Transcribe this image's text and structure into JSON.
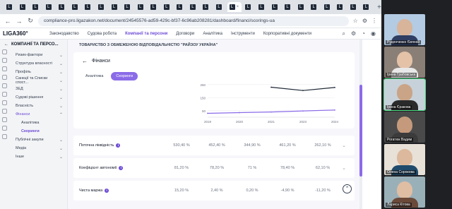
{
  "browser": {
    "tab_count": 28,
    "tab_close": "×",
    "new_tab": "+",
    "url": "compliance-pro.ligazakon.net/document/24545576-ad59-429c-bf37-6c96ab208281/dashboard/financi/scorings-ua",
    "nav": {
      "back": "←",
      "forward": "→",
      "reload": "↻"
    }
  },
  "app": {
    "logo": "LIGA360°",
    "nav": [
      "Законодавство",
      "Судова робота",
      "Компанії та персони",
      "Договори",
      "Аналітика",
      "Інструменти",
      "Корпоративні документи"
    ],
    "active_nav": 2
  },
  "sidebar": {
    "back_label": "КОМПАНІЇ ТА ПЕРСО...",
    "items": [
      {
        "label": "Ризик-фактори",
        "chev": "⌄"
      },
      {
        "label": "Структура власності",
        "chev": "⌄"
      },
      {
        "label": "Профіль",
        "chev": "⌄"
      },
      {
        "label": "Санкції та Списки спост...",
        "chev": "⌄"
      },
      {
        "label": "ЗЕД",
        "chev": "⌄"
      },
      {
        "label": "Судові рішення",
        "chev": "⌄"
      },
      {
        "label": "Власність",
        "chev": "⌄"
      },
      {
        "label": "Фінанси",
        "chev": "⌃"
      }
    ],
    "sub_items": [
      "Аналітика",
      "Скоринги"
    ],
    "items_after": [
      {
        "label": "Публічні закупи",
        "chev": "⌄"
      },
      {
        "label": "Медіа",
        "chev": "⌄"
      },
      {
        "label": "Інше",
        "chev": "⌄"
      }
    ]
  },
  "main": {
    "company": "ТОВАРИСТВО З ОБМЕЖЕНОЮ ВІДПОВІДАЛЬНІСТЮ \"РАЙЗОУ УКРАЇНА\"",
    "title": "Фінанси",
    "tabs": [
      "Аналітика",
      "Скоринги"
    ],
    "active_tab": 1,
    "rows": [
      {
        "label": "Поточна ліквідність",
        "values": [
          "530,40 %",
          "452,40 %",
          "344,90 %",
          "461,20 %",
          "262,10 %"
        ]
      },
      {
        "label": "Коефіцієнт автономії",
        "values": [
          "81,20 %",
          "78,20 %",
          "71 %",
          "78,40 %",
          "62,10 %"
        ]
      },
      {
        "label": "Чиста маржа",
        "values": [
          "15,20 %",
          "2,40 %",
          "0,20 %",
          "-4,90 %",
          "-11,20 %"
        ]
      }
    ]
  },
  "chart_data": {
    "type": "line",
    "x": [
      "2019",
      "2020",
      "2021",
      "2023",
      "2024"
    ],
    "y_ticks": [
      "250",
      "150",
      "50"
    ],
    "series": [
      {
        "values": [
          null,
          null,
          230,
          205,
          228
        ],
        "color": "#1f2937"
      },
      {
        "values": [
          30,
          35,
          40,
          48,
          55
        ],
        "color": "#8b6be8"
      }
    ]
  },
  "video_participants": [
    {
      "name": "Руденченко Євгеній"
    },
    {
      "name": "Ірина Грабовська"
    },
    {
      "name": "Ірина Єракова"
    },
    {
      "name": "Рогатюк Вадим"
    },
    {
      "name": "Олена Сорокова"
    },
    {
      "name": "Лариса Кітова"
    }
  ],
  "colors": {
    "accent": "#6d4ad6",
    "accent_light": "#8b6be8",
    "speaker_outline": "#4ade80"
  }
}
